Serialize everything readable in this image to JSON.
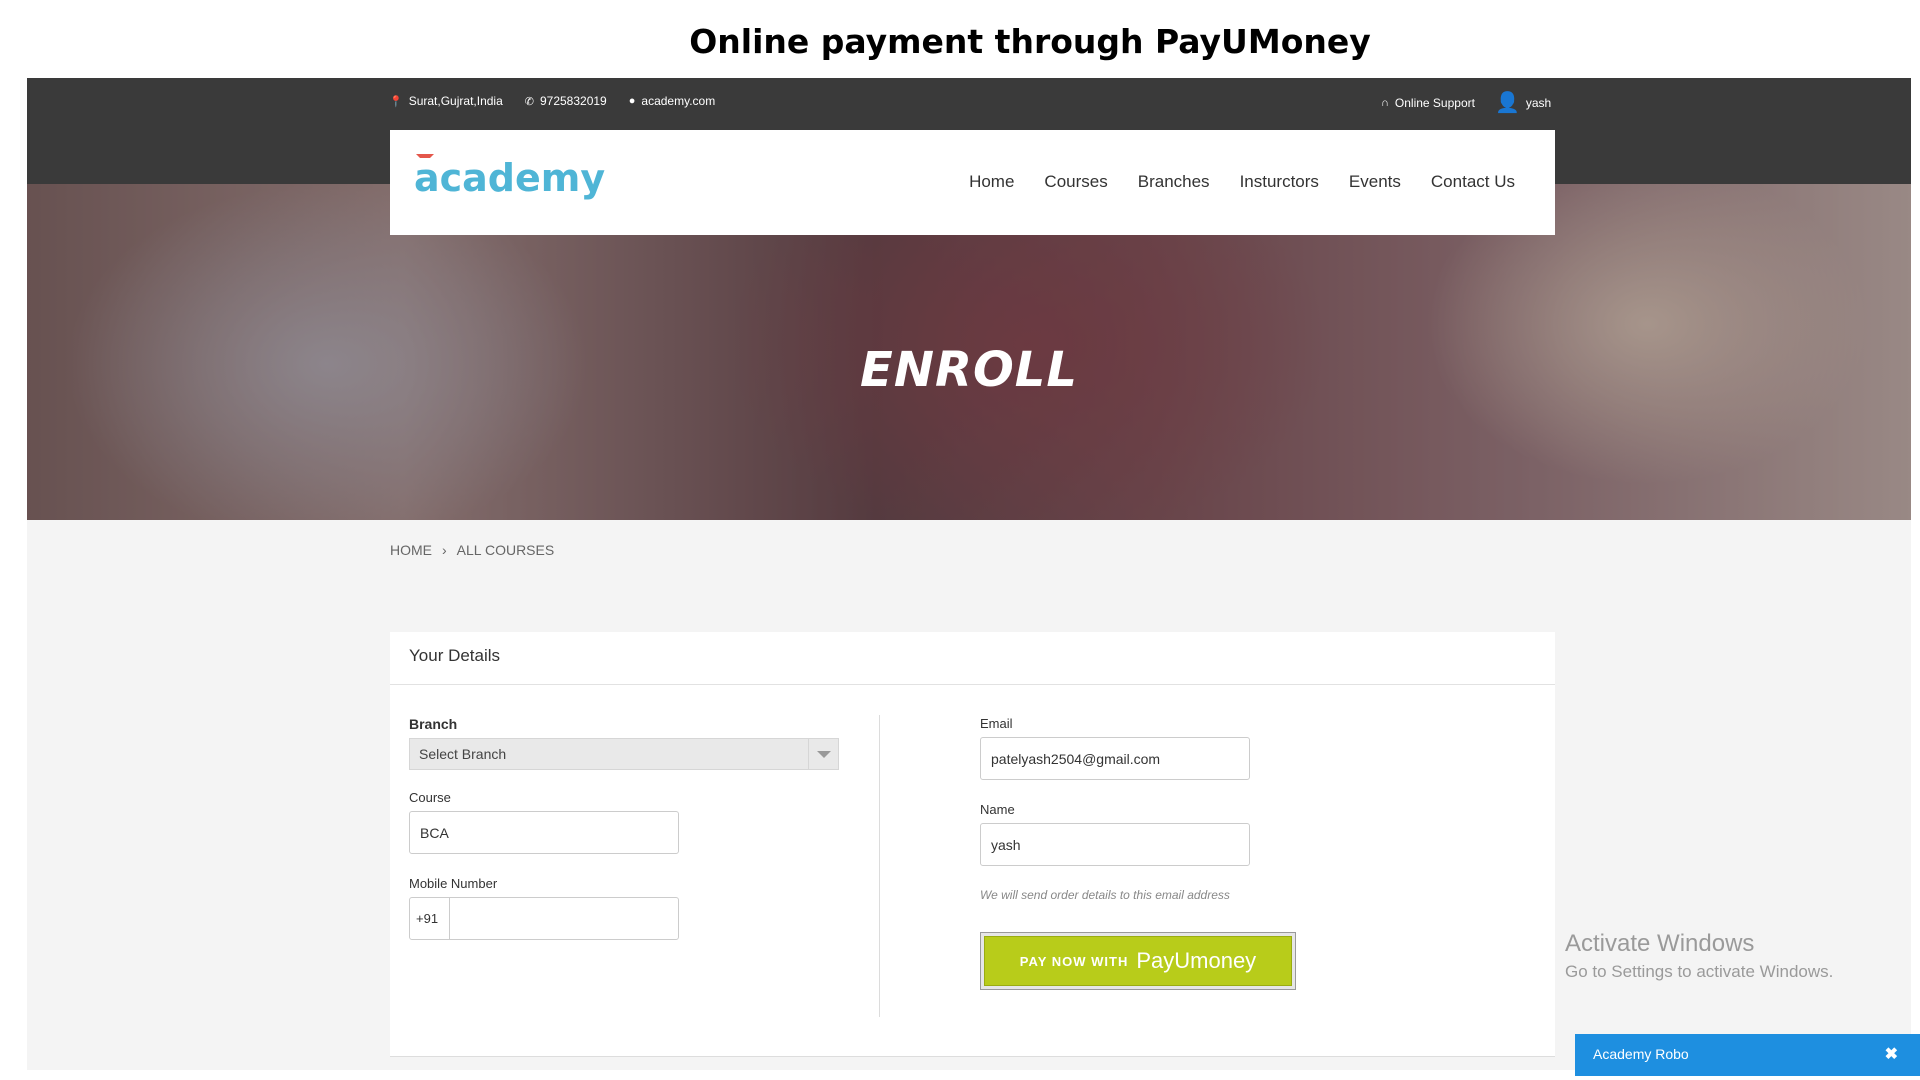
{
  "slide_title": "Online payment through PayUMoney",
  "topbar": {
    "location": "Surat,Gujrat,India",
    "phone": "9725832019",
    "website": "academy.com",
    "support": "Online Support",
    "user": "yash"
  },
  "brand": {
    "logo": "academy"
  },
  "nav": {
    "items": [
      "Home",
      "Courses",
      "Branches",
      "Insturctors",
      "Events",
      "Contact Us"
    ]
  },
  "hero": {
    "title": "ENROLL"
  },
  "breadcrumb": {
    "home": "HOME",
    "separator": "›",
    "current": "ALL COURSES"
  },
  "form": {
    "heading": "Your Details",
    "branch_label": "Branch",
    "branch_value": "Select Branch",
    "course_label": "Course",
    "course_value": "BCA",
    "mobile_label": "Mobile Number",
    "mobile_code": "+91",
    "mobile_value": "",
    "email_label": "Email",
    "email_value": "patelyash2504@gmail.com",
    "name_label": "Name",
    "name_value": "yash",
    "hint": "We will send order details to this email address",
    "pay_prefix": "PAY NOW WITH",
    "pay_brand": "PayUmoney"
  },
  "watermark": {
    "line1": "Activate Windows",
    "line2": "Go to Settings to activate Windows."
  },
  "chat": {
    "title": "Academy Robo",
    "close": "✖"
  },
  "colors": {
    "accent": "#1e8fe0",
    "pay_button": "#b8cc1a",
    "logo": "#4fb5d6",
    "topbar": "#3a3a3a"
  }
}
